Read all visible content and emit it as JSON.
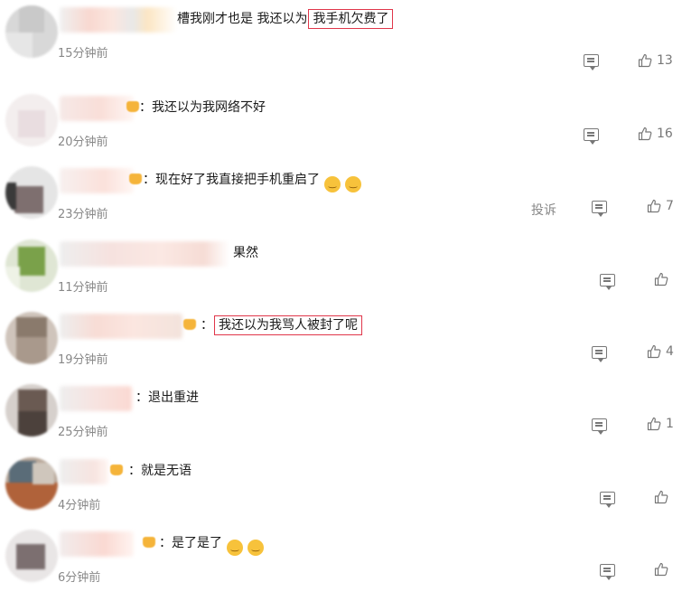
{
  "comments": [
    {
      "text_before": "槽我刚才也是 我还以为",
      "highlight": "我手机欠费了",
      "text_after": "",
      "time": "15分钟前",
      "likes": "13",
      "report": "",
      "emoji_count": 0
    },
    {
      "text_before": "：我还以为我网络不好",
      "highlight": "",
      "text_after": "",
      "time": "20分钟前",
      "likes": "16",
      "report": "",
      "emoji_count": 0
    },
    {
      "text_before": "：现在好了我直接把手机重启了",
      "highlight": "",
      "text_after": "",
      "time": "23分钟前",
      "likes": "7",
      "report": "投诉",
      "emoji_count": 2
    },
    {
      "text_before": "果然",
      "highlight": "",
      "text_after": "",
      "time": "11分钟前",
      "likes": "",
      "report": "",
      "emoji_count": 0
    },
    {
      "text_before": "：",
      "highlight": "我还以为我骂人被封了呢",
      "text_after": "",
      "time": "19分钟前",
      "likes": "4",
      "report": "",
      "emoji_count": 0
    },
    {
      "text_before": "：退出重进",
      "highlight": "",
      "text_after": "",
      "time": "25分钟前",
      "likes": "1",
      "report": "",
      "emoji_count": 0
    },
    {
      "text_before": "：就是无语",
      "highlight": "",
      "text_after": "",
      "time": "4分钟前",
      "likes": "",
      "report": "",
      "emoji_count": 0
    },
    {
      "text_before": "：是了是了",
      "highlight": "",
      "text_after": "",
      "time": "6分钟前",
      "likes": "",
      "report": "",
      "emoji_count": 2
    }
  ],
  "icons": {
    "reply": "comment-icon",
    "like": "thumbs-up-icon",
    "emoji": "laughing-face-emoji"
  },
  "colors": {
    "highlight_border": "#e0364a",
    "meta_text": "#888888",
    "badge": "#f5b43a"
  }
}
